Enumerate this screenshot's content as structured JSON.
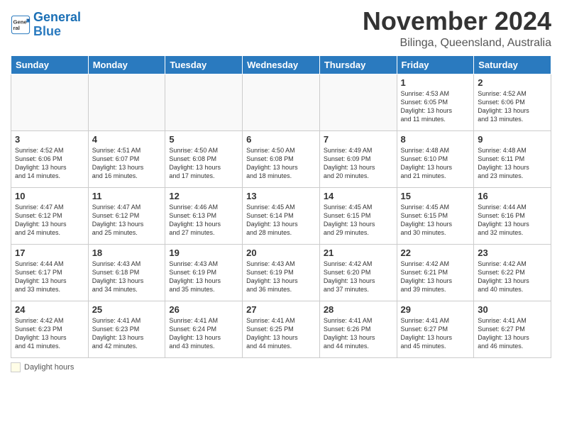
{
  "header": {
    "logo_line1": "General",
    "logo_line2": "Blue",
    "month": "November 2024",
    "location": "Bilinga, Queensland, Australia"
  },
  "days_of_week": [
    "Sunday",
    "Monday",
    "Tuesday",
    "Wednesday",
    "Thursday",
    "Friday",
    "Saturday"
  ],
  "weeks": [
    [
      {
        "day": "",
        "info": ""
      },
      {
        "day": "",
        "info": ""
      },
      {
        "day": "",
        "info": ""
      },
      {
        "day": "",
        "info": ""
      },
      {
        "day": "",
        "info": ""
      },
      {
        "day": "1",
        "info": "Sunrise: 4:53 AM\nSunset: 6:05 PM\nDaylight: 13 hours\nand 11 minutes."
      },
      {
        "day": "2",
        "info": "Sunrise: 4:52 AM\nSunset: 6:06 PM\nDaylight: 13 hours\nand 13 minutes."
      }
    ],
    [
      {
        "day": "3",
        "info": "Sunrise: 4:52 AM\nSunset: 6:06 PM\nDaylight: 13 hours\nand 14 minutes."
      },
      {
        "day": "4",
        "info": "Sunrise: 4:51 AM\nSunset: 6:07 PM\nDaylight: 13 hours\nand 16 minutes."
      },
      {
        "day": "5",
        "info": "Sunrise: 4:50 AM\nSunset: 6:08 PM\nDaylight: 13 hours\nand 17 minutes."
      },
      {
        "day": "6",
        "info": "Sunrise: 4:50 AM\nSunset: 6:08 PM\nDaylight: 13 hours\nand 18 minutes."
      },
      {
        "day": "7",
        "info": "Sunrise: 4:49 AM\nSunset: 6:09 PM\nDaylight: 13 hours\nand 20 minutes."
      },
      {
        "day": "8",
        "info": "Sunrise: 4:48 AM\nSunset: 6:10 PM\nDaylight: 13 hours\nand 21 minutes."
      },
      {
        "day": "9",
        "info": "Sunrise: 4:48 AM\nSunset: 6:11 PM\nDaylight: 13 hours\nand 23 minutes."
      }
    ],
    [
      {
        "day": "10",
        "info": "Sunrise: 4:47 AM\nSunset: 6:12 PM\nDaylight: 13 hours\nand 24 minutes."
      },
      {
        "day": "11",
        "info": "Sunrise: 4:47 AM\nSunset: 6:12 PM\nDaylight: 13 hours\nand 25 minutes."
      },
      {
        "day": "12",
        "info": "Sunrise: 4:46 AM\nSunset: 6:13 PM\nDaylight: 13 hours\nand 27 minutes."
      },
      {
        "day": "13",
        "info": "Sunrise: 4:45 AM\nSunset: 6:14 PM\nDaylight: 13 hours\nand 28 minutes."
      },
      {
        "day": "14",
        "info": "Sunrise: 4:45 AM\nSunset: 6:15 PM\nDaylight: 13 hours\nand 29 minutes."
      },
      {
        "day": "15",
        "info": "Sunrise: 4:45 AM\nSunset: 6:15 PM\nDaylight: 13 hours\nand 30 minutes."
      },
      {
        "day": "16",
        "info": "Sunrise: 4:44 AM\nSunset: 6:16 PM\nDaylight: 13 hours\nand 32 minutes."
      }
    ],
    [
      {
        "day": "17",
        "info": "Sunrise: 4:44 AM\nSunset: 6:17 PM\nDaylight: 13 hours\nand 33 minutes."
      },
      {
        "day": "18",
        "info": "Sunrise: 4:43 AM\nSunset: 6:18 PM\nDaylight: 13 hours\nand 34 minutes."
      },
      {
        "day": "19",
        "info": "Sunrise: 4:43 AM\nSunset: 6:19 PM\nDaylight: 13 hours\nand 35 minutes."
      },
      {
        "day": "20",
        "info": "Sunrise: 4:43 AM\nSunset: 6:19 PM\nDaylight: 13 hours\nand 36 minutes."
      },
      {
        "day": "21",
        "info": "Sunrise: 4:42 AM\nSunset: 6:20 PM\nDaylight: 13 hours\nand 37 minutes."
      },
      {
        "day": "22",
        "info": "Sunrise: 4:42 AM\nSunset: 6:21 PM\nDaylight: 13 hours\nand 39 minutes."
      },
      {
        "day": "23",
        "info": "Sunrise: 4:42 AM\nSunset: 6:22 PM\nDaylight: 13 hours\nand 40 minutes."
      }
    ],
    [
      {
        "day": "24",
        "info": "Sunrise: 4:42 AM\nSunset: 6:23 PM\nDaylight: 13 hours\nand 41 minutes."
      },
      {
        "day": "25",
        "info": "Sunrise: 4:41 AM\nSunset: 6:23 PM\nDaylight: 13 hours\nand 42 minutes."
      },
      {
        "day": "26",
        "info": "Sunrise: 4:41 AM\nSunset: 6:24 PM\nDaylight: 13 hours\nand 43 minutes."
      },
      {
        "day": "27",
        "info": "Sunrise: 4:41 AM\nSunset: 6:25 PM\nDaylight: 13 hours\nand 44 minutes."
      },
      {
        "day": "28",
        "info": "Sunrise: 4:41 AM\nSunset: 6:26 PM\nDaylight: 13 hours\nand 44 minutes."
      },
      {
        "day": "29",
        "info": "Sunrise: 4:41 AM\nSunset: 6:27 PM\nDaylight: 13 hours\nand 45 minutes."
      },
      {
        "day": "30",
        "info": "Sunrise: 4:41 AM\nSunset: 6:27 PM\nDaylight: 13 hours\nand 46 minutes."
      }
    ]
  ],
  "legend": {
    "box_label": "Daylight hours"
  }
}
